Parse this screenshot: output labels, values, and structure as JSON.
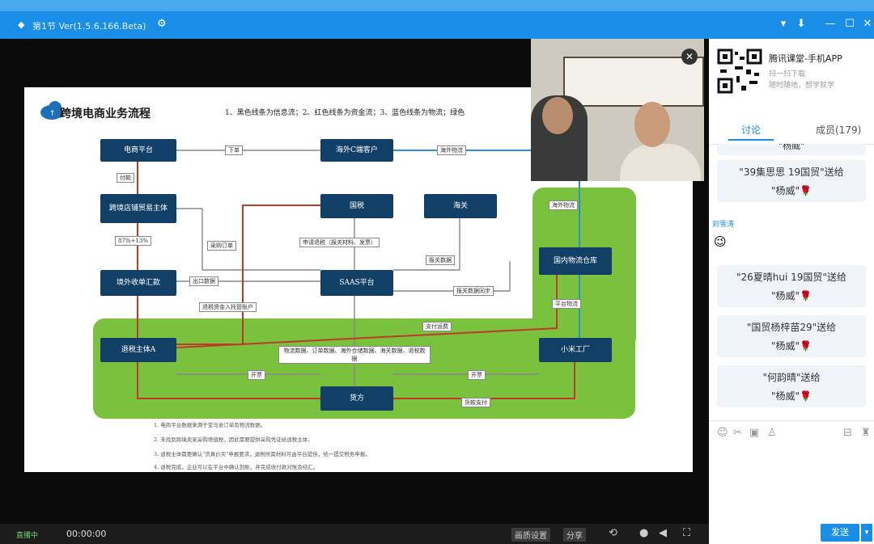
{
  "window": {
    "title": "第1节 Ver(1.5.6.166.Beta)"
  },
  "slide": {
    "title": "跨境电商业务流程",
    "note": "1、黑色线条为信息流；2、红色线条为资金流；3、蓝色线条为物流；绿色",
    "nodes": {
      "ecom_platform": "电商平台",
      "overseas_customer": "海外C端客户",
      "cross_border_seller": "跨境店铺贸易主体",
      "foreign_tax": "国税",
      "customs": "海关",
      "overseas_collection": "境外收单汇款",
      "saas": "SAAS平台",
      "domestic_logistics": "国内物流仓库",
      "exporter": "退税主体A",
      "factory": "小米工厂",
      "buyer": "货方"
    },
    "labels": {
      "order": "下单",
      "overseas_logistics": "海外物流",
      "payment": "付款",
      "ratio": "87%+13%",
      "purchase_order": "采购订单",
      "declare": "申请退税（报关材料、发票）",
      "customs_data": "报关数据",
      "export_data": "出口数据",
      "overseas_logistics2": "海外物流",
      "data_sync": "报关数据同步",
      "settlement": "汇款数据",
      "transfer": "退税资金入托管账户",
      "platform_logistics": "平台物流",
      "payout": "支付运费",
      "data_box": "物流数据、订单数据、海外仓储数据、海关数据、退税数据",
      "invoice1": "开票",
      "invoice2": "开票",
      "pay_goods": "货款支付"
    },
    "footer": [
      "1.  电商平台数据来源于亚马逊订单及物流数据。",
      "2.  未找到跨境卖家采购增值税，因此需要提供采购凭证给退税主体。",
      "3.  退税主体需要确认\"货真价实\"申报要求，退税所需材料可由平台提供，统一提交税务申报。",
      "4.  退税完成，企业可以在平台中确认到账，并完成收付款对账及结汇。"
    ]
  },
  "bottombar": {
    "time": "00:00:00",
    "status": "直播中",
    "btn1": "画质设置",
    "btn2": "分享"
  },
  "sidebar": {
    "app_title": "腾讯课堂-手机APP",
    "app_sub1": "扫一扫下载",
    "app_sub2": "随时随地，想学就学",
    "tab_discuss": "讨论",
    "tab_members": "成员(179)",
    "partial_top": "\"杨威\"",
    "messages": [
      {
        "line": "\"39集思思 19国贸\"送给",
        "to": "\"杨威\""
      },
      {
        "line": "\"26夏晴hui 19国贸\"送给",
        "to": "\"杨威\""
      },
      {
        "line": "\"国贸杨梓苗29\"送给",
        "to": "\"杨威\""
      },
      {
        "line": "\"何韵晴\"送给",
        "to": "\"杨威\""
      }
    ],
    "user_name": "刘雪涛",
    "send_label": "发送"
  },
  "colors": {
    "titlebar": "#1a8ee6",
    "accent": "#1a8ee6",
    "node": "#123f66",
    "green": "#7ac13e",
    "red": "#c0392b",
    "blue": "#2b8fd0"
  }
}
